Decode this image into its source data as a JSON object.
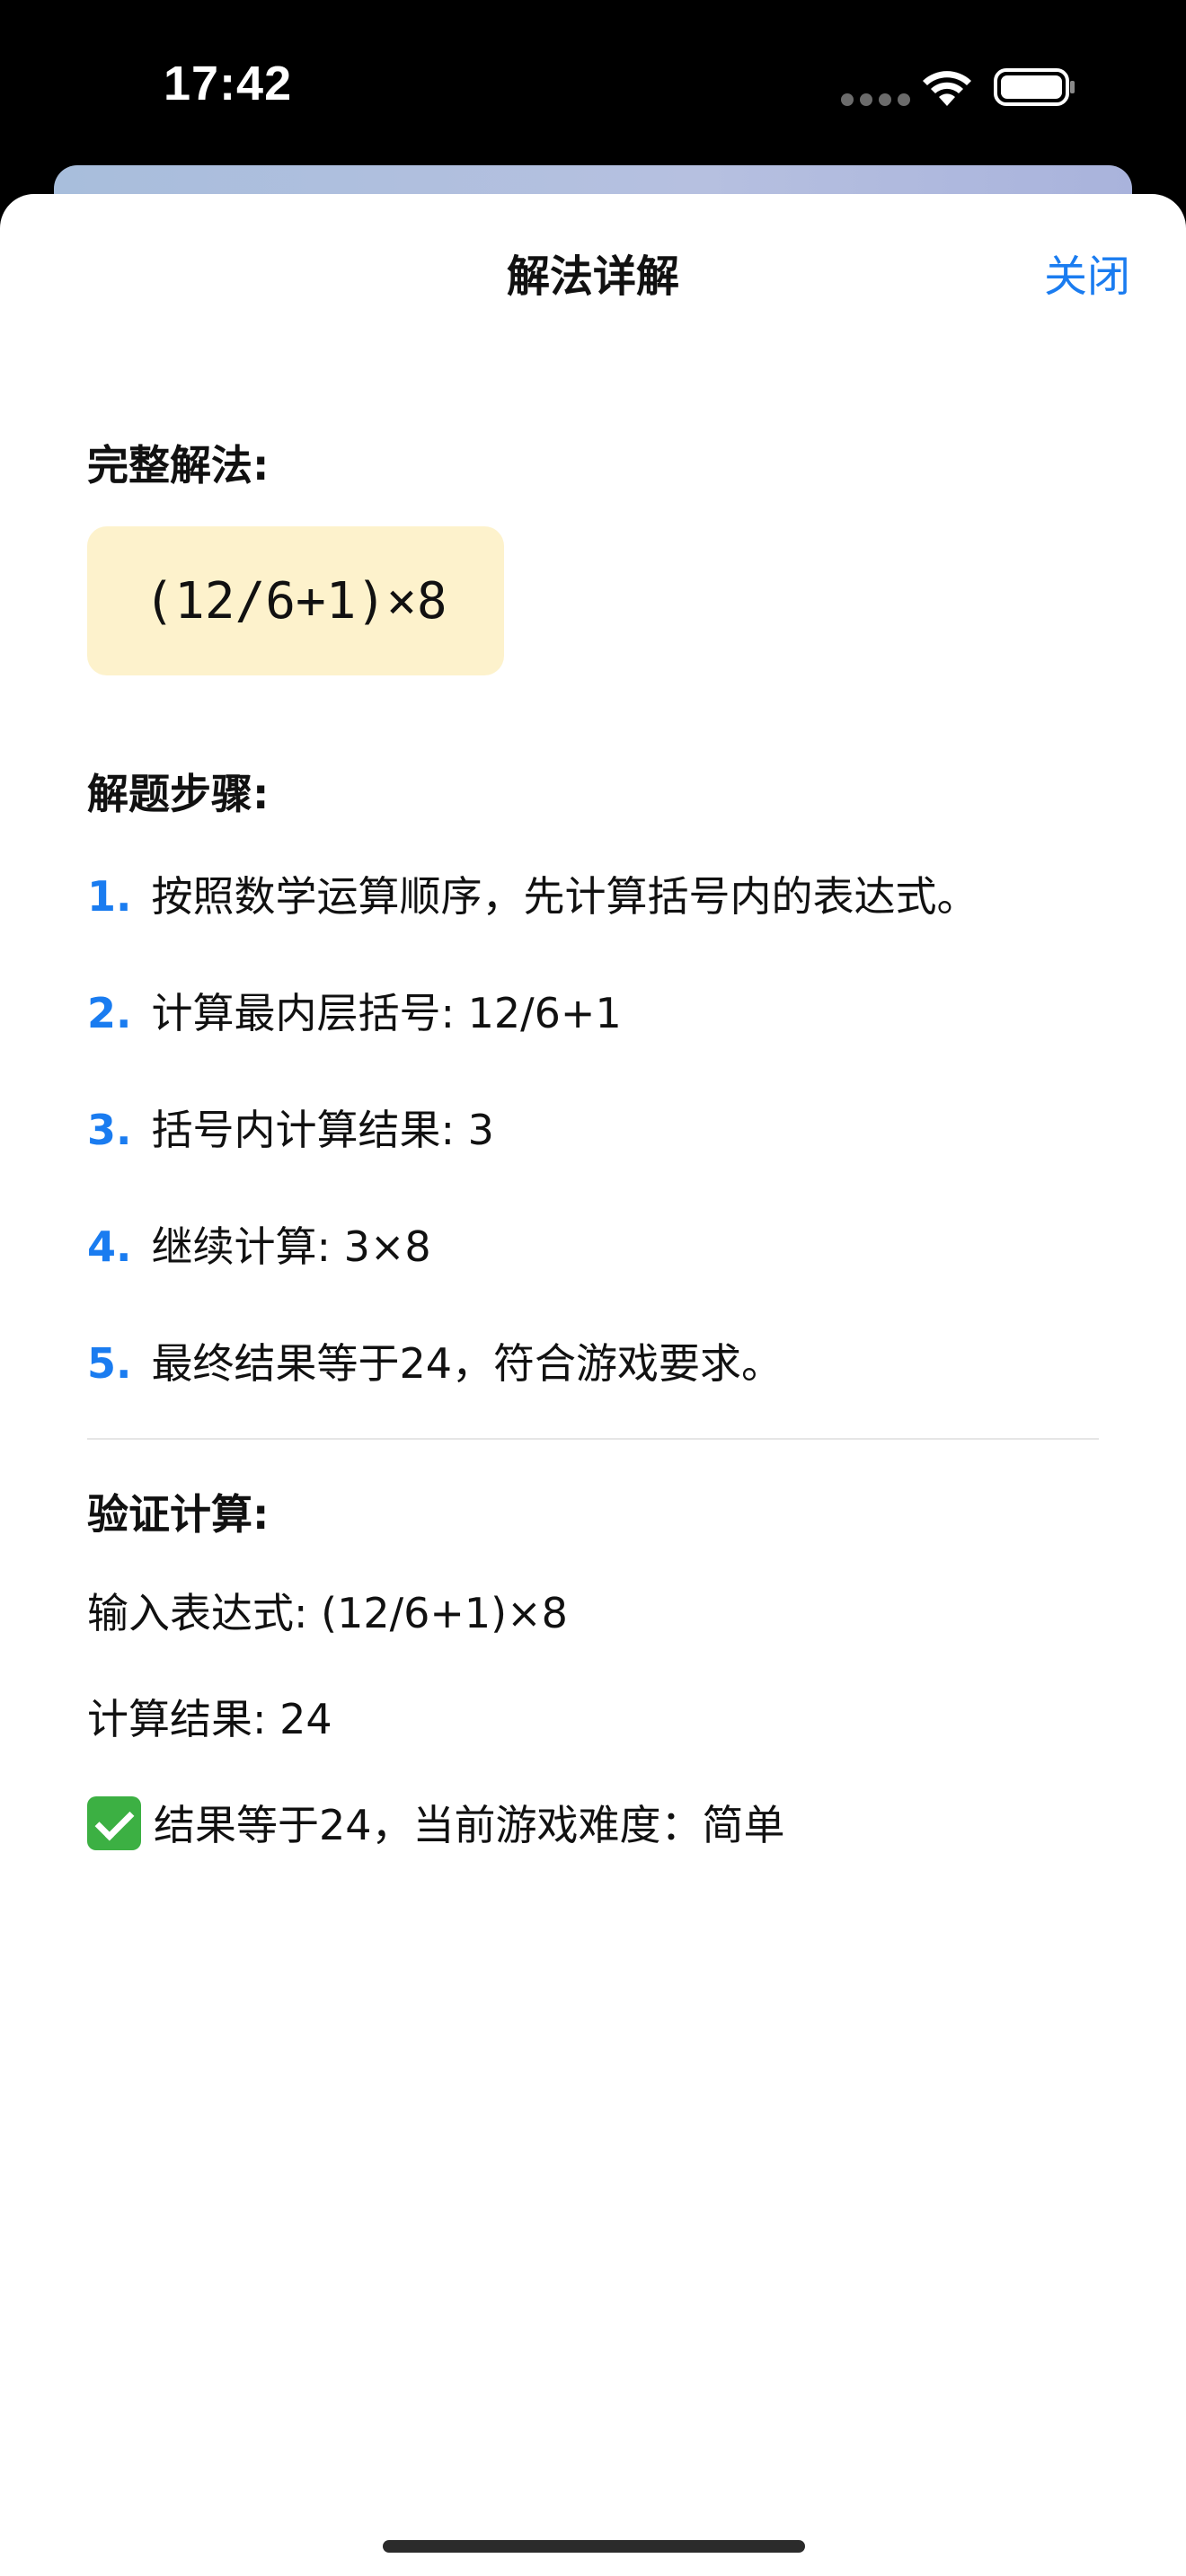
{
  "status_bar": {
    "time": "17:42"
  },
  "nav": {
    "title": "解法详解",
    "close_label": "关闭"
  },
  "solution": {
    "label": "完整解法:",
    "formula": "(12/6+1)×8"
  },
  "steps": {
    "label": "解题步骤:",
    "items": [
      {
        "num": "1.",
        "text": "按照数学运算顺序，先计算括号内的表达式。"
      },
      {
        "num": "2.",
        "text": "计算最内层括号: 12/6+1"
      },
      {
        "num": "3.",
        "text": "括号内计算结果: 3"
      },
      {
        "num": "4.",
        "text": "继续计算: 3×8"
      },
      {
        "num": "5.",
        "text": "最终结果等于24，符合游戏要求。"
      }
    ]
  },
  "verify": {
    "label": "验证计算:",
    "input_expression": "输入表达式: (12/6+1)×8",
    "result": "计算结果: 24",
    "conclusion": "结果等于24，当前游戏难度：简单"
  },
  "colors": {
    "accent": "#1a7cf0",
    "formula_bg": "#fdf2cc",
    "check_green": "#3cb043"
  }
}
